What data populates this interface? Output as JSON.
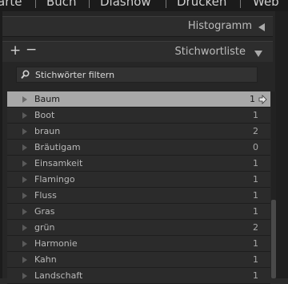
{
  "menubar": {
    "items": [
      {
        "label": "arte"
      },
      {
        "label": "Buch"
      },
      {
        "label": "Diashow"
      },
      {
        "label": "Drucken"
      },
      {
        "label": "Web"
      }
    ]
  },
  "histogram_panel": {
    "title": "Histogramm"
  },
  "keyword_panel": {
    "title": "Stichwortliste",
    "add_label": "+",
    "remove_label": "−",
    "filter_placeholder": "Stichwörter filtern"
  },
  "keywords": [
    {
      "name": "Baum",
      "count": "1",
      "selected": true
    },
    {
      "name": "Boot",
      "count": "1"
    },
    {
      "name": "braun",
      "count": "2"
    },
    {
      "name": "Bräutigam",
      "count": "0"
    },
    {
      "name": "Einsamkeit",
      "count": "1"
    },
    {
      "name": "Flamingo",
      "count": "1"
    },
    {
      "name": "Fluss",
      "count": "1"
    },
    {
      "name": "Gras",
      "count": "1"
    },
    {
      "name": "grün",
      "count": "2"
    },
    {
      "name": "Harmonie",
      "count": "1"
    },
    {
      "name": "Kahn",
      "count": "1"
    },
    {
      "name": "Landschaft",
      "count": "1"
    }
  ],
  "colors": {
    "panel_bg": "#262626",
    "row_bg": "#2b2b2b",
    "selected_row": "#a8a8a8",
    "text": "#b8b8b8"
  }
}
